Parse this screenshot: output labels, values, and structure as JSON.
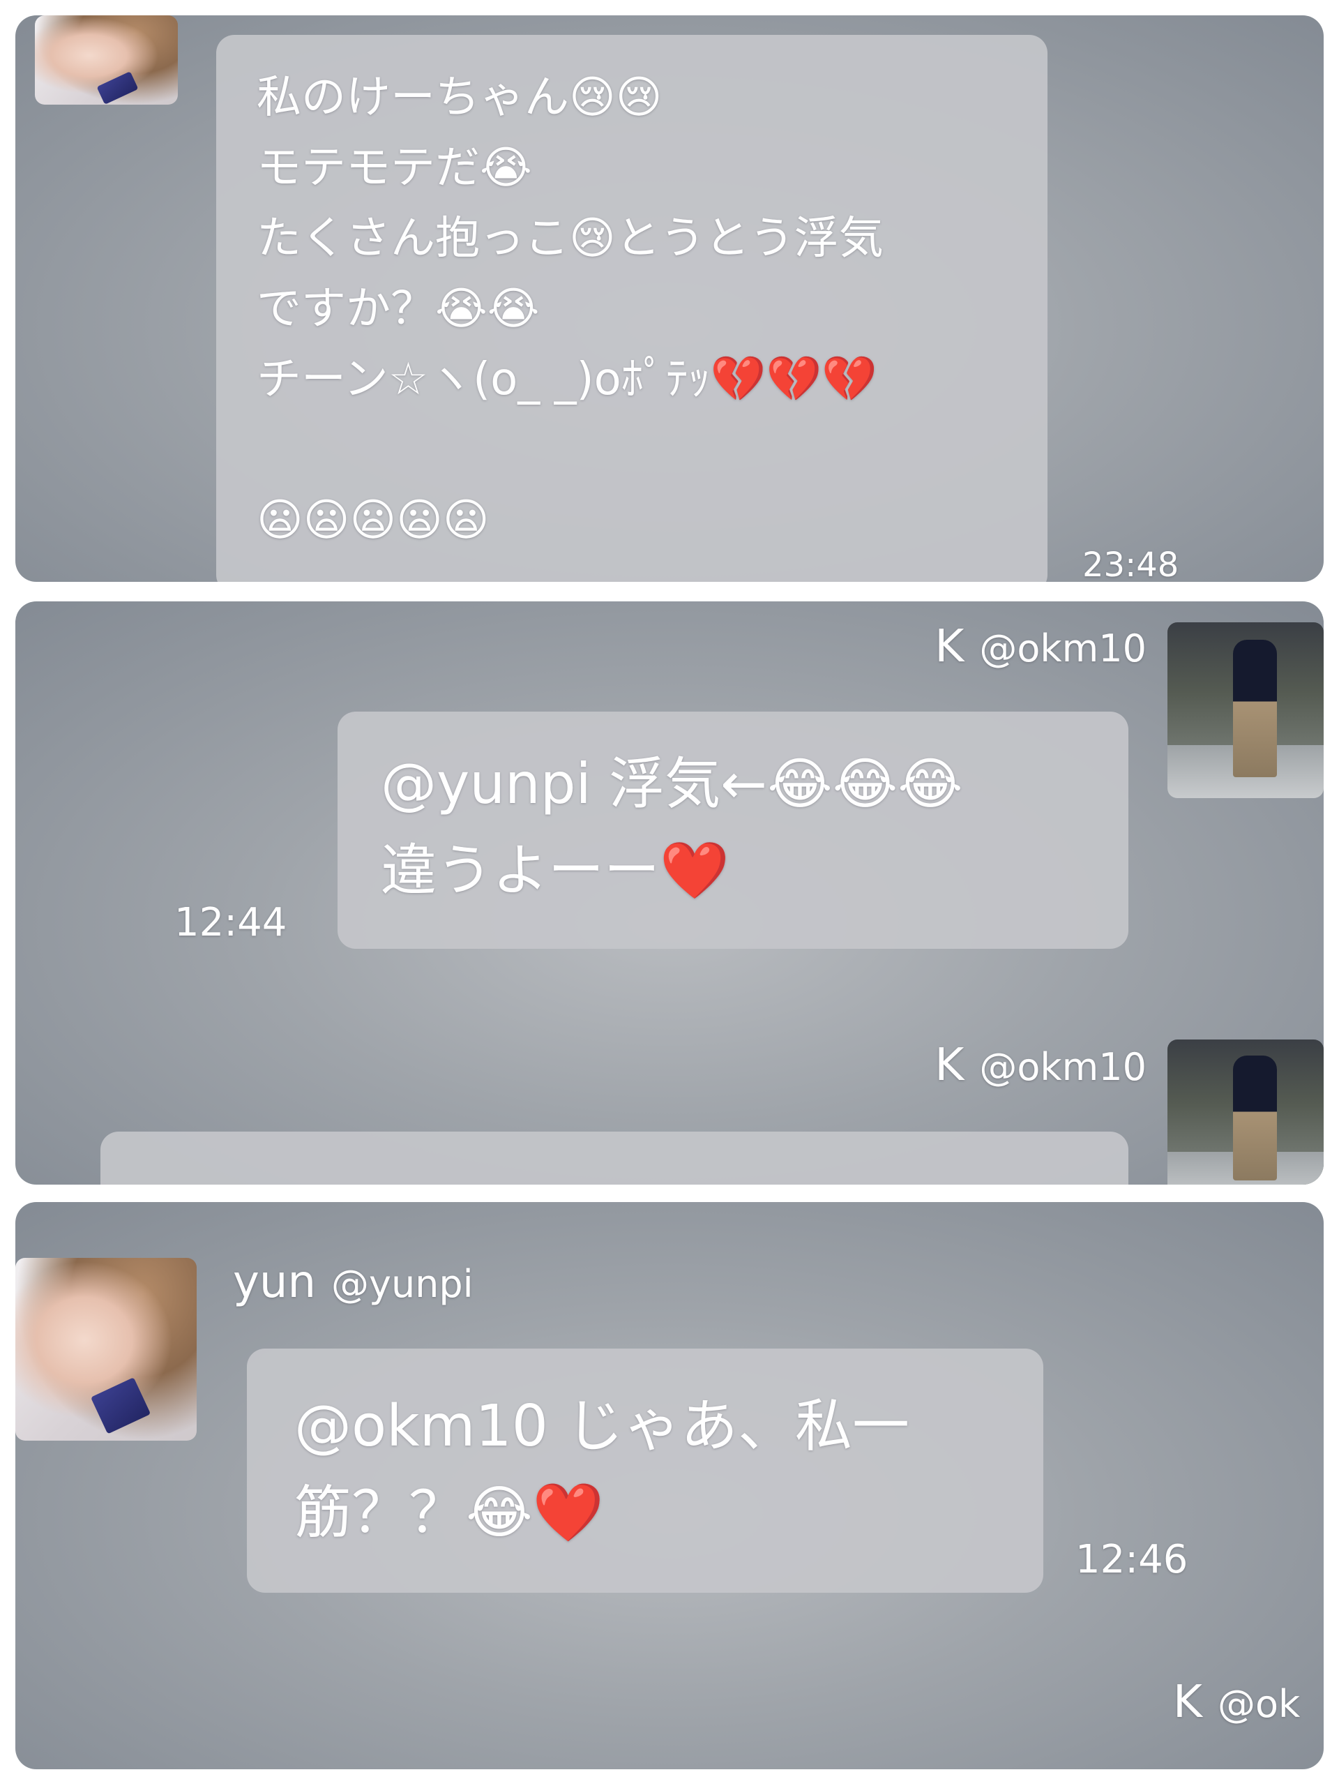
{
  "panel1": {
    "message": "私のけーちゃん😢😢\nモテモテだ😭\nたくさん抱っこ😢とうとう浮気\nですか？😭😭\nチーン☆ヽ(o_ _)oﾎﾟﾃｯ💔💔💔\n\n😦😦😦😦😦",
    "time": "23:48"
  },
  "panel2": {
    "sender_name": "K",
    "sender_handle": "@okm10",
    "message": "@yunpi 浮気←😂😂😂\n違うよーー❤️",
    "time": "12:44",
    "second_sender_name": "K",
    "second_sender_handle": "@okm10"
  },
  "panel3": {
    "sender_name": "yun",
    "sender_handle": "@yunpi",
    "message": "@okm10 じゃあ、私一\n筋？？😂❤️",
    "time": "12:46",
    "next_sender_name": "K",
    "next_sender_handle": "@ok"
  },
  "icons": {
    "avatar_yun": "avatar-photo-girl",
    "avatar_k": "avatar-photo-man-walking"
  }
}
